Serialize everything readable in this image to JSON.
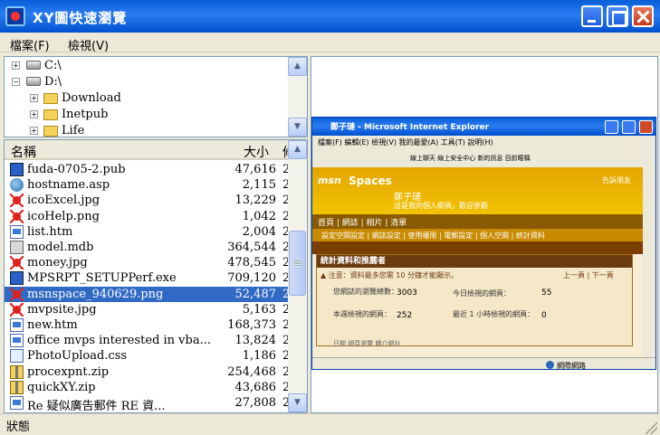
{
  "window": {
    "title": "XY圖快速瀏覽"
  },
  "menu": {
    "file": "檔案(F)",
    "view": "檢視(V)"
  },
  "tree": [
    {
      "label": "C:\\",
      "type": "drive",
      "expander": "+"
    },
    {
      "label": "D:\\",
      "type": "drive",
      "expander": "−"
    },
    {
      "label": "Download",
      "type": "folder",
      "expander": "+"
    },
    {
      "label": "Inetpub",
      "type": "folder",
      "expander": "+"
    },
    {
      "label": "Life",
      "type": "folder",
      "expander": "+"
    }
  ],
  "list": {
    "headers": {
      "name": "名稱",
      "size": "大小",
      "date": "修"
    },
    "rows": [
      {
        "name": "fuda-0705-2.pub",
        "size": "47,616",
        "date": "2",
        "icon": "publisher-icon"
      },
      {
        "name": "hostname.asp",
        "size": "2,115",
        "date": "2",
        "icon": "globe-icon"
      },
      {
        "name": "icoExcel.jpg",
        "size": "13,229",
        "date": "2",
        "icon": "red-splat-icon"
      },
      {
        "name": "icoHelp.png",
        "size": "1,042",
        "date": "2",
        "icon": "red-splat-icon"
      },
      {
        "name": "list.htm",
        "size": "2,004",
        "date": "2",
        "icon": "html-doc-icon"
      },
      {
        "name": "model.mdb",
        "size": "364,544",
        "date": "2",
        "icon": "database-icon"
      },
      {
        "name": "money.jpg",
        "size": "478,545",
        "date": "2",
        "icon": "red-splat-icon"
      },
      {
        "name": "MPSRPT_SETUPPerf.exe",
        "size": "709,120",
        "date": "2",
        "icon": "exe-icon"
      },
      {
        "name": "msnspace_940629.png",
        "size": "52,487",
        "date": "2",
        "icon": "red-splat-icon",
        "selected": true
      },
      {
        "name": "mvpsite.jpg",
        "size": "5,163",
        "date": "2",
        "icon": "red-splat-icon"
      },
      {
        "name": "new.htm",
        "size": "168,373",
        "date": "2",
        "icon": "html-doc-icon"
      },
      {
        "name": "office mvps interested in vba...",
        "size": "13,824",
        "date": "2",
        "icon": "html-doc-icon"
      },
      {
        "name": "PhotoUpload.css",
        "size": "1,186",
        "date": "2",
        "icon": "css-icon"
      },
      {
        "name": "procexpnt.zip",
        "size": "254,468",
        "date": "2",
        "icon": "zip-icon"
      },
      {
        "name": "quickXY.zip",
        "size": "43,686",
        "date": "2",
        "icon": "zip-icon"
      },
      {
        "name": "Re 疑似廣告郵件 RE 資...",
        "size": "27,808",
        "date": "2",
        "icon": "mail-icon"
      }
    ]
  },
  "preview": {
    "ie_title": "鄭子璉 - Microsoft Internet Explorer",
    "ie_menu": "檔案(F)  編輯(E)  檢視(V)  我的最愛(A)  工具(T)  說明(H)",
    "msn_top": "線上聊天   線上安全中心   新的訊息   目前暱稱",
    "msn_logo": "msn",
    "msn_spaces": "Spaces",
    "blog_title": "鄭子璉",
    "blog_sub": "這是我的個人網頁，歡迎參觀",
    "header_right": "告訴朋友",
    "nav": "首頁 | 網誌 | 相片 | 清單",
    "subnav": "設定空間設定 | 網誌設定 | 使用權限 | 電郵設定 | 個人空間 | 統計資料",
    "stats_title": "統計資料和推薦者",
    "stats_note": "▲ 注意：資料最多您需 10 分鐘才能顯示。",
    "stats_nav": "上一頁 | 下一頁",
    "stat_total_label": "您網誌的瀏覽總數：",
    "stat_total_value": "3003",
    "stat_today_label": "今日檢視的網頁：",
    "stat_today_value": "55",
    "stat_week_label": "本週檢視的網頁：",
    "stat_week_value": "252",
    "stat_hour_label": "最近 1 小時檢視的網頁：",
    "stat_hour_value": "0",
    "stats_cols": "日期          網頁瀏覽          轉介網址",
    "ie_status": "網際網路"
  },
  "status": {
    "text": "狀態"
  }
}
